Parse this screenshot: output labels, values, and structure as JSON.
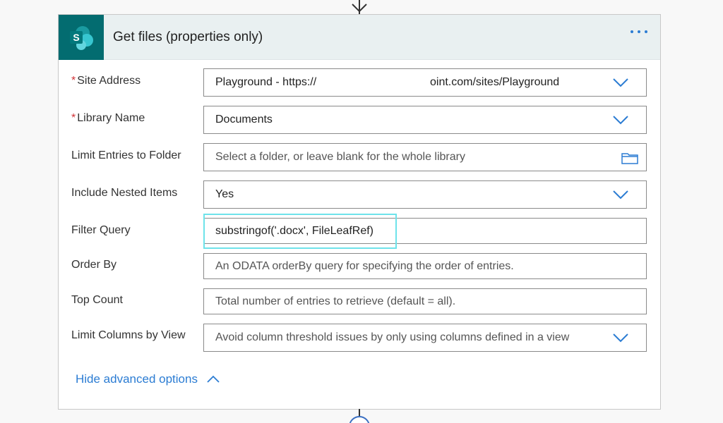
{
  "card": {
    "title": "Get files (properties only)",
    "icon": "sharepoint-logo",
    "accent_color": "#036c70",
    "link_color": "#2b7cd3"
  },
  "fields": {
    "site_address": {
      "label": "Site Address",
      "required": true,
      "value_left": "Playground - https://",
      "value_right": "oint.com/sites/Playground"
    },
    "library_name": {
      "label": "Library Name",
      "required": true,
      "value": "Documents"
    },
    "limit_folder": {
      "label": "Limit Entries to Folder",
      "placeholder": "Select a folder, or leave blank for the whole library"
    },
    "nested_items": {
      "label": "Include Nested Items",
      "value": "Yes"
    },
    "filter_query": {
      "label": "Filter Query",
      "value": "substringof('.docx', FileLeafRef)"
    },
    "order_by": {
      "label": "Order By",
      "placeholder": "An ODATA orderBy query for specifying the order of entries."
    },
    "top_count": {
      "label": "Top Count",
      "placeholder": "Total number of entries to retrieve (default = all)."
    },
    "limit_columns": {
      "label": "Limit Columns by View",
      "placeholder": "Avoid column threshold issues by only using columns defined in a view"
    }
  },
  "advanced": {
    "label": "Hide advanced options",
    "icon": "chevron-up-icon"
  },
  "required_marker": "*"
}
